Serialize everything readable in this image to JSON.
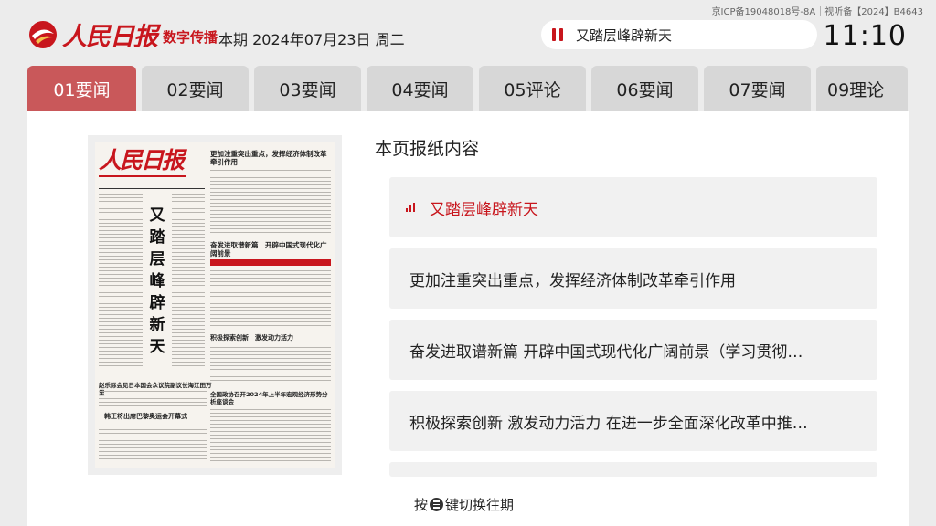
{
  "header": {
    "logo_text": "人民日报",
    "logo_subtitle": "数字传播",
    "issue_date": "本期 2024年07月23日 周二",
    "now_playing": "又踏层峰辟新天",
    "icp_text": "京ICP备19048018号-8A｜视听备【2024】B4643",
    "clock": "11:10"
  },
  "tabs": [
    {
      "label": "01要闻",
      "active": true
    },
    {
      "label": "02要闻"
    },
    {
      "label": "03要闻"
    },
    {
      "label": "04要闻"
    },
    {
      "label": "05评论"
    },
    {
      "label": "06要闻"
    },
    {
      "label": "07要闻"
    },
    {
      "label": "09理论"
    }
  ],
  "thumbnail": {
    "masthead": "人民日报",
    "headline_1": "更加注重突出重点，发挥经济体制改革牵引作用",
    "headline_2": "奋发进取谱新篇　开辟中国式现代化广阔前景",
    "vertical_headline": "又踏层峰辟新天",
    "headline_3": "积极探索创新　激发动力活力",
    "headline_4": "赵乐际会见日本国会众议院副议长海江田万里",
    "headline_5": "全国政协召开2024年上半年宏观经济形势分析座谈会",
    "headline_6": "韩正将出席巴黎奥运会开幕式"
  },
  "content": {
    "title": "本页报纸内容",
    "items": [
      {
        "text": "又踏层峰辟新天",
        "active": true
      },
      {
        "text": "更加注重突出重点，发挥经济体制改革牵引作用"
      },
      {
        "text": "奋发进取谱新篇 开辟中国式现代化广阔前景（学习贯彻…"
      },
      {
        "text": "积极探索创新 激发动力活力 在进一步全面深化改革中推…"
      }
    ],
    "hint_prefix": "按",
    "hint_suffix": "键切换往期"
  },
  "colors": {
    "brand_red": "#c8161d",
    "active_tab": "#c9585a"
  }
}
